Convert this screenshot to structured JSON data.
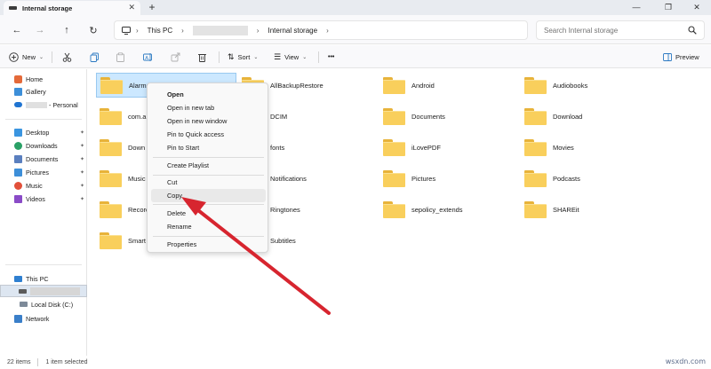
{
  "tab": {
    "title": "Internal storage",
    "close": "✕",
    "new_tab": "+"
  },
  "window": {
    "minimize": "—",
    "maximize": "❐",
    "close": "✕"
  },
  "nav": {
    "back": "←",
    "forward": "→",
    "up": "↑",
    "refresh": "↻"
  },
  "address": {
    "crumbs": [
      "This PC",
      "Internal storage"
    ],
    "sep": "›"
  },
  "search": {
    "placeholder": "Search Internal storage"
  },
  "toolbar": {
    "new_label": "New",
    "sort_label": "Sort",
    "view_label": "View",
    "more_label": "•••",
    "preview_label": "Preview"
  },
  "sidebar": {
    "items": [
      {
        "label": "Home",
        "icon": "home-icon"
      },
      {
        "label": "Gallery",
        "icon": "gallery-icon"
      },
      {
        "label": "- Personal",
        "icon": "cloud-icon"
      },
      {
        "label": "Desktop",
        "icon": "desktop-icon",
        "pinned": true
      },
      {
        "label": "Downloads",
        "icon": "downloads-icon",
        "pinned": true
      },
      {
        "label": "Documents",
        "icon": "documents-icon",
        "pinned": true
      },
      {
        "label": "Pictures",
        "icon": "pictures-icon",
        "pinned": true
      },
      {
        "label": "Music",
        "icon": "music-icon",
        "pinned": true
      },
      {
        "label": "Videos",
        "icon": "videos-icon",
        "pinned": true
      },
      {
        "label": "This PC",
        "icon": "this-pc-icon"
      },
      {
        "label": "Local Disk (C:)",
        "icon": "drive-icon"
      },
      {
        "label": "Network",
        "icon": "network-icon"
      }
    ],
    "pin": "📌"
  },
  "files": [
    {
      "name": "Alarms",
      "selected": true
    },
    {
      "name": "AllBackupRestore"
    },
    {
      "name": "Android"
    },
    {
      "name": "Audiobooks"
    },
    {
      "name": "com.a"
    },
    {
      "name": "DCIM"
    },
    {
      "name": "Documents"
    },
    {
      "name": "Download"
    },
    {
      "name": "Down"
    },
    {
      "name": "fonts"
    },
    {
      "name": "iLovePDF"
    },
    {
      "name": "Movies"
    },
    {
      "name": "Music"
    },
    {
      "name": "Notifications"
    },
    {
      "name": "Pictures"
    },
    {
      "name": "Podcasts"
    },
    {
      "name": "Record"
    },
    {
      "name": "Ringtones"
    },
    {
      "name": "sepolicy_extends"
    },
    {
      "name": "SHAREit"
    },
    {
      "name": "Smart"
    },
    {
      "name": "Subtitles"
    }
  ],
  "context_menu": {
    "open": "Open",
    "open_new_tab": "Open in new tab",
    "open_new_window": "Open in new window",
    "pin_quick_access": "Pin to Quick access",
    "pin_start": "Pin to Start",
    "create_playlist": "Create Playlist",
    "cut": "Cut",
    "copy": "Copy",
    "delete": "Delete",
    "rename": "Rename",
    "properties": "Properties"
  },
  "status": {
    "items_count": "22 items",
    "selected_count": "1 item selected"
  },
  "watermark": "wsxdn.com",
  "colors": {
    "annotation_arrow": "#d7252f",
    "selection": "#cce8ff",
    "folder": "#f9cf5c"
  }
}
